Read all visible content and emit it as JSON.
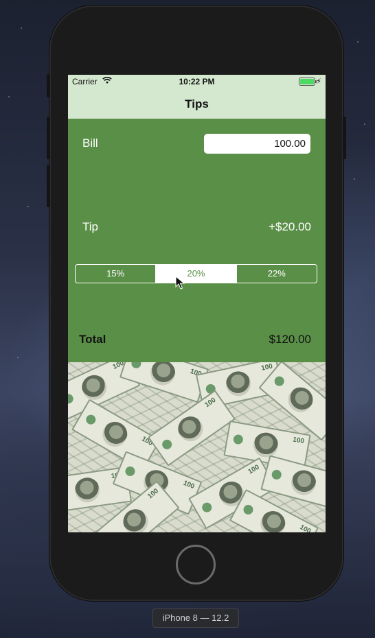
{
  "status_bar": {
    "carrier": "Carrier",
    "time": "10:22 PM",
    "battery_charging_icon": "bolt-icon",
    "wifi_icon": "wifi-icon"
  },
  "nav": {
    "title": "Tips"
  },
  "bill": {
    "label": "Bill",
    "value": "100.00"
  },
  "tip": {
    "label": "Tip",
    "value": "+$20.00"
  },
  "tip_selector": {
    "options": [
      "15%",
      "20%",
      "22%"
    ],
    "selected": "20%"
  },
  "total": {
    "label": "Total",
    "value": "$120.00"
  },
  "device": {
    "label": "iPhone 8 — 12.2"
  },
  "colors": {
    "bar_background": "#d4e7cf",
    "content_background": "#5a8f47",
    "accent": "#5a8f47"
  }
}
